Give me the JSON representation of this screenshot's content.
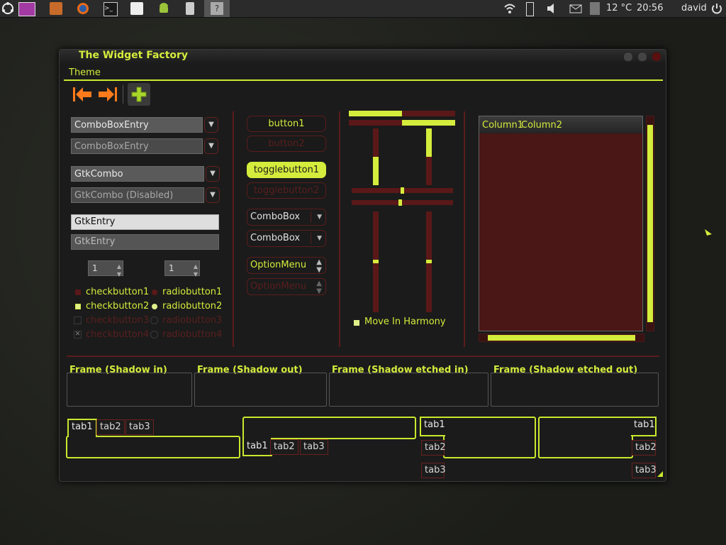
{
  "panel": {
    "temperature": "12 °C",
    "clock": "20:56",
    "user": "david",
    "icons": [
      "ubuntu-logo-icon",
      "app-menu-icon",
      "files-icon",
      "firefox-icon",
      "terminal-icon",
      "text-editor-icon",
      "android-icon",
      "usb-icon",
      "help-icon",
      "wifi-icon",
      "battery-icon",
      "volume-icon",
      "mail-icon",
      "weather-icon",
      "power-icon"
    ]
  },
  "window": {
    "title": "The Widget Factory",
    "menu": {
      "theme": "Theme"
    }
  },
  "combos": {
    "entry1": "ComboBoxEntry",
    "entry2": "ComboBoxEntry",
    "gtk1": "GtkCombo",
    "gtk2": "GtkCombo (Disabled)"
  },
  "entries": {
    "entry1": "GtkEntry",
    "entry2": "GtkEntry"
  },
  "spins": {
    "spin1": "1",
    "spin2": "1"
  },
  "checks": {
    "c1": "checkbutton1",
    "c2": "checkbutton2",
    "c3": "checkbutton3",
    "c4": "checkbutton4",
    "r1": "radiobutton1",
    "r2": "radiobutton2",
    "r3": "radiobutton3",
    "r4": "radiobutton4"
  },
  "buttons": {
    "b1": "button1",
    "b2": "button2",
    "t1": "togglebutton1",
    "t2": "togglebutton2",
    "cb1": "ComboBox",
    "cb2": "ComboBox",
    "om1": "OptionMenu",
    "om2": "OptionMenu"
  },
  "harmony": "Move In Harmony",
  "sliders": {
    "h1": 0.5,
    "h2": 0.5,
    "v1": 0.5,
    "v2": 0.5,
    "scale_h1": 0.5,
    "scale_h2": 0.5,
    "scale_v1": 0.5,
    "scale_v2": 0.5
  },
  "treeview": {
    "col1": "Column1",
    "col2": "Column2"
  },
  "frames": {
    "f1": "Frame (Shadow in)",
    "f2": "Frame (Shadow out)",
    "f3": "Frame (Shadow etched in)",
    "f4": "Frame (Shadow etched out)"
  },
  "tabs": {
    "t1": "tab1",
    "t2": "tab2",
    "t3": "tab3"
  },
  "colors": {
    "accent": "#d4ec3c",
    "dark_red": "#5a1818",
    "bg": "#1b1b1b"
  }
}
